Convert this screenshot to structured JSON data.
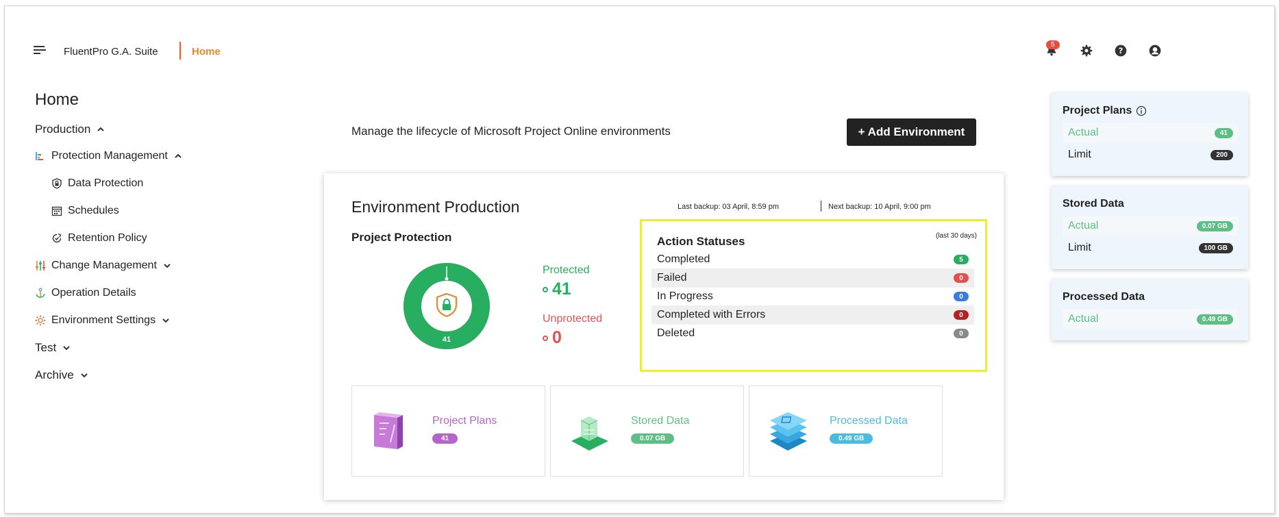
{
  "header": {
    "app_title": "FluentPro G.A. Suite",
    "breadcrumb": "Home",
    "notifications_count": "5"
  },
  "sidebar": {
    "heading": "Home",
    "production": "Production",
    "protection_management": "Protection Management",
    "data_protection": "Data Protection",
    "schedules": "Schedules",
    "retention_policy": "Retention Policy",
    "change_management": "Change Management",
    "operation_details": "Operation Details",
    "environment_settings": "Environment Settings",
    "test": "Test",
    "archive": "Archive"
  },
  "main": {
    "subtitle": "Manage the lifecycle of Microsoft Project Online environments",
    "add_button": "+ Add Environment"
  },
  "env": {
    "title": "Environment Production",
    "last_backup": "Last backup: 03 April, 8:59 pm",
    "next_backup": "Next backup: 10 April, 9:00 pm",
    "project_protection": "Project Protection",
    "donut_value": "41",
    "protected_label": "Protected",
    "protected_value": "41",
    "unprotected_label": "Unprotected",
    "unprotected_value": "0",
    "protected_fraction": 1.0
  },
  "statuses": {
    "title": "Action Statuses",
    "note": "(last 30 days)",
    "rows": [
      {
        "label": "Completed",
        "count": "5",
        "color": "#27ae60"
      },
      {
        "label": "Failed",
        "count": "0",
        "color": "#e05252"
      },
      {
        "label": "In Progress",
        "count": "0",
        "color": "#3b7dd8"
      },
      {
        "label": "Completed with Errors",
        "count": "0",
        "color": "#b22222"
      },
      {
        "label": "Deleted",
        "count": "0",
        "color": "#8a8a8a"
      }
    ]
  },
  "tiles": [
    {
      "label": "Project Plans",
      "value": "41",
      "color": "#b565c9"
    },
    {
      "label": "Stored Data",
      "value": "0.07 GB",
      "color": "#5dbf83"
    },
    {
      "label": "Processed Data",
      "value": "0.49 GB",
      "color": "#4bbbe0"
    }
  ],
  "panels": {
    "project_plans": {
      "title": "Project Plans",
      "actual_label": "Actual",
      "actual_value": "41",
      "limit_label": "Limit",
      "limit_value": "200"
    },
    "stored_data": {
      "title": "Stored Data",
      "actual_label": "Actual",
      "actual_value": "0.07 GB",
      "limit_label": "Limit",
      "limit_value": "100 GB"
    },
    "processed_data": {
      "title": "Processed Data",
      "actual_label": "Actual",
      "actual_value": "0.49 GB"
    }
  },
  "colors": {
    "accent": "#e2892b",
    "green": "#27ae60",
    "red": "#e05252",
    "highlight": "#f2ec2a"
  }
}
